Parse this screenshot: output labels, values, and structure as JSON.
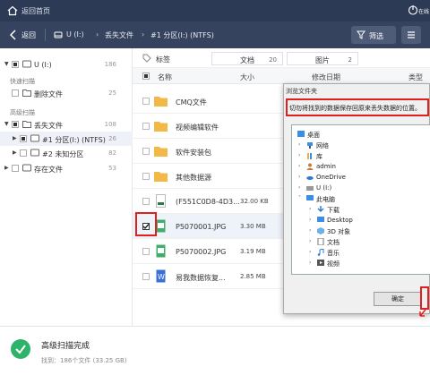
{
  "topbar": {
    "home_label": "返回首页",
    "online_label": "在线"
  },
  "navbar": {
    "back_label": "返回",
    "breadcrumbs": [
      "U (I:)",
      "丢失文件",
      "#1 分区(I:) (NTFS)"
    ],
    "filter_label": "筛选"
  },
  "sidebar": {
    "root": {
      "label": "U (I:)",
      "count": "186"
    },
    "quick_scan_title": "快速扫描",
    "deleted": {
      "label": "删除文件",
      "count": "25"
    },
    "advanced_scan_title": "高级扫描",
    "lost": {
      "label": "丢失文件",
      "count": "108"
    },
    "partition1": {
      "label": "#1 分区(I:) (NTFS)",
      "count": "26"
    },
    "partition2": {
      "label": "#2 未知分区",
      "count": "82"
    },
    "existing": {
      "label": "存在文件",
      "count": "53"
    }
  },
  "main": {
    "tag_label": "标签",
    "tabs": [
      {
        "label": "文档",
        "count": "20"
      },
      {
        "label": "图片",
        "count": "2"
      }
    ],
    "columns": {
      "name": "名称",
      "size": "大小",
      "date": "修改日期",
      "type": "类型"
    },
    "rows": [
      {
        "name": "CMQ文件",
        "size": "",
        "kind": "folder"
      },
      {
        "name": "视频编辑软件",
        "size": "",
        "kind": "folder"
      },
      {
        "name": "软件安装包",
        "size": "",
        "kind": "folder"
      },
      {
        "name": "其他数据源",
        "size": "",
        "kind": "folder"
      },
      {
        "name": "(F551C0D8-4D3...",
        "size": "32.00 KB",
        "kind": "file"
      },
      {
        "name": "P5070001.JPG",
        "size": "3.30 MB",
        "kind": "jpg",
        "checked": true
      },
      {
        "name": "P5070002.JPG",
        "size": "3.19 MB",
        "kind": "jpg"
      },
      {
        "name": "易我数据恢复...",
        "size": "2.85 MB",
        "kind": "doc"
      }
    ]
  },
  "dialog": {
    "title": "浏览文件夹",
    "message": "切勿将找到的数据保存回原来丢失数据的位置。",
    "tree": [
      "桌面",
      "网络",
      "库",
      "admin",
      "OneDrive",
      "U (I:)",
      "此电脑",
      "下载",
      "Desktop",
      "3D 对象",
      "文档",
      "音乐",
      "视频"
    ],
    "ok_label": "确定"
  },
  "status": {
    "title": "高级扫描完成",
    "detail": "找到：186个文件 (33.25 GB)"
  },
  "colors": {
    "topbar": "#2d3a56",
    "navbar": "#36435f",
    "highlight": "#e02020",
    "success": "#2fb36b"
  }
}
